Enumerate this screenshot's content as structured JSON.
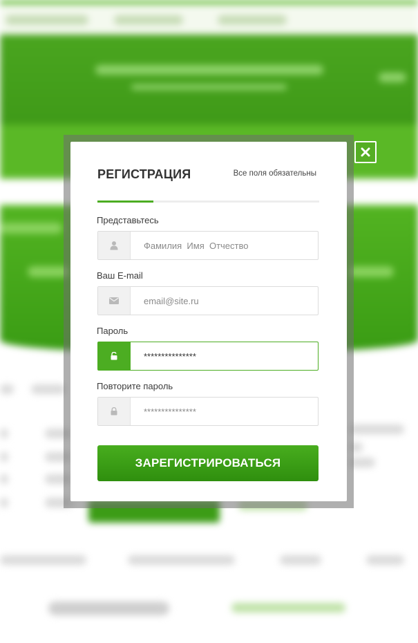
{
  "modal": {
    "title": "РЕГИСТРАЦИЯ",
    "required_note": "Все поля обязательны",
    "fields": [
      {
        "label": "Представьтесь",
        "placeholder": "Фамилия  Имя  Отчество",
        "value": "",
        "icon": "user-icon",
        "type": "text"
      },
      {
        "label": "Ваш E-mail",
        "placeholder": "email@site.ru",
        "value": "",
        "icon": "envelope-icon",
        "type": "email"
      },
      {
        "label": "Пароль",
        "placeholder": "",
        "value": "***************",
        "icon": "unlock-icon",
        "type": "text",
        "focused": true
      },
      {
        "label": "Повторите пароль",
        "placeholder": "***************",
        "value": "",
        "icon": "lock-icon",
        "type": "text"
      }
    ],
    "submit_label": "ЗАРЕГИСТРИРОВАТЬСЯ",
    "close_icon": "close-icon"
  },
  "colors": {
    "accent": "#4cad22",
    "button_top": "#48ad1e",
    "button_bottom": "#2f8f0e",
    "title_text": "#333333"
  }
}
